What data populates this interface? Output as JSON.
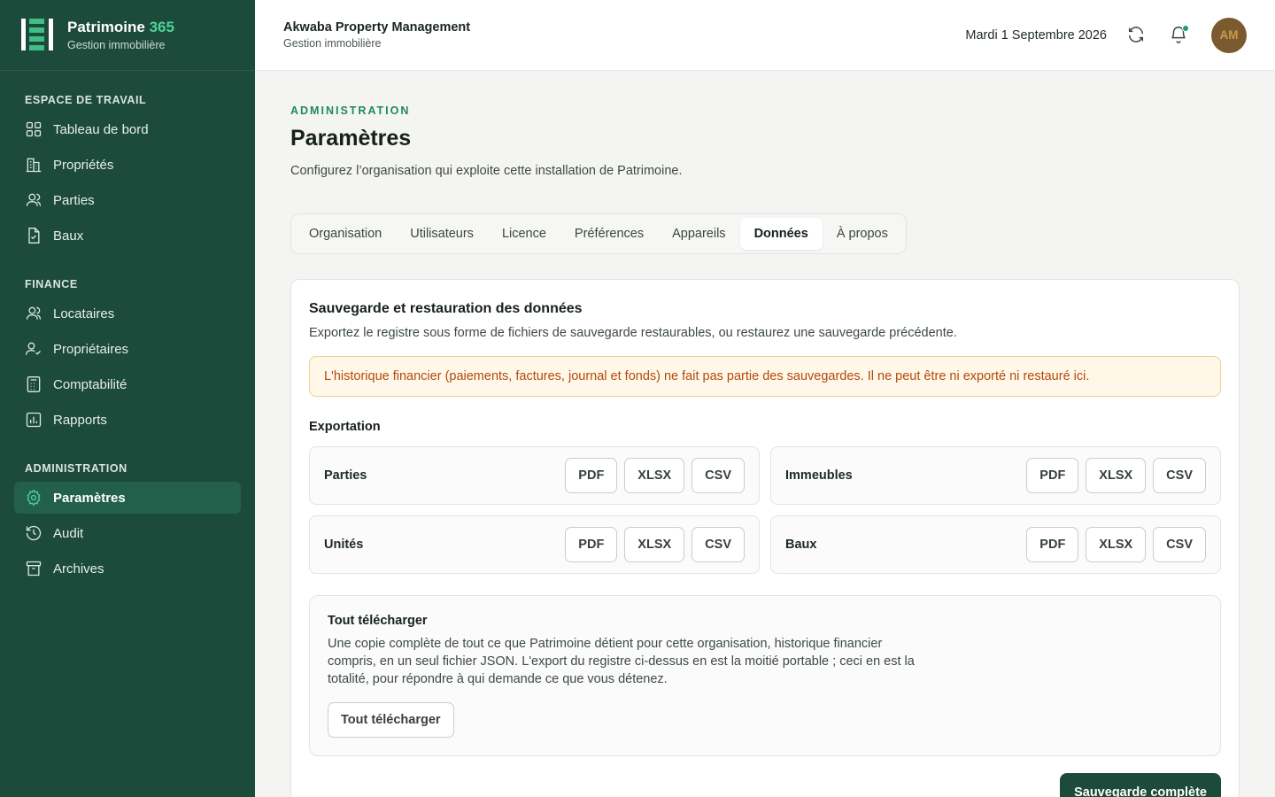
{
  "brand": {
    "name_main": "Patrimoine",
    "name_accent": "365",
    "subtitle": "Gestion immobilière"
  },
  "sidebar": {
    "sections": [
      {
        "heading": "ESPACE DE TRAVAIL",
        "items": [
          {
            "label": "Tableau de bord",
            "icon": "dashboard-icon"
          },
          {
            "label": "Propriétés",
            "icon": "building-icon"
          },
          {
            "label": "Parties",
            "icon": "users-icon"
          },
          {
            "label": "Baux",
            "icon": "document-icon"
          }
        ]
      },
      {
        "heading": "FINANCE",
        "items": [
          {
            "label": "Locataires",
            "icon": "tenants-icon"
          },
          {
            "label": "Propriétaires",
            "icon": "owner-icon"
          },
          {
            "label": "Comptabilité",
            "icon": "calculator-icon"
          },
          {
            "label": "Rapports",
            "icon": "chart-icon"
          }
        ]
      },
      {
        "heading": "ADMINISTRATION",
        "items": [
          {
            "label": "Paramètres",
            "icon": "gear-icon",
            "active": true
          },
          {
            "label": "Audit",
            "icon": "history-icon"
          },
          {
            "label": "Archives",
            "icon": "archive-icon"
          }
        ]
      }
    ]
  },
  "header": {
    "org_name": "Akwaba Property Management",
    "org_subtitle": "Gestion immobilière",
    "date": "Mardi 1 Septembre 2026",
    "avatar_initials": "AM"
  },
  "page": {
    "eyebrow": "ADMINISTRATION",
    "title": "Paramètres",
    "description": "Configurez l’organisation qui exploite cette installation de Patrimoine."
  },
  "tabs": [
    {
      "label": "Organisation"
    },
    {
      "label": "Utilisateurs"
    },
    {
      "label": "Licence"
    },
    {
      "label": "Préférences"
    },
    {
      "label": "Appareils"
    },
    {
      "label": "Données",
      "active": true
    },
    {
      "label": "À propos"
    }
  ],
  "card": {
    "title": "Sauvegarde et restauration des données",
    "description": "Exportez le registre sous forme de fichiers de sauvegarde restaurables, ou restaurez une sauvegarde précédente.",
    "warning": "L'historique financier (paiements, factures, journal et fonds) ne fait pas partie des sauvegardes. Il ne peut être ni exporté ni restauré ici.",
    "export_label": "Exportation",
    "exports": [
      {
        "name": "Parties",
        "formats": [
          "PDF",
          "XLSX",
          "CSV"
        ]
      },
      {
        "name": "Immeubles",
        "formats": [
          "PDF",
          "XLSX",
          "CSV"
        ]
      },
      {
        "name": "Unités",
        "formats": [
          "PDF",
          "XLSX",
          "CSV"
        ]
      },
      {
        "name": "Baux",
        "formats": [
          "PDF",
          "XLSX",
          "CSV"
        ]
      }
    ],
    "download": {
      "title": "Tout télécharger",
      "description": "Une copie complète de tout ce que Patrimoine détient pour cette organisation, historique financier compris, en un seul fichier JSON. L'export du registre ci-dessus en est la moitié portable ; ceci en est la totalité, pour répondre à qui demande ce que vous détenez.",
      "button": "Tout télécharger"
    },
    "primary_button": "Sauvegarde complète"
  },
  "colors": {
    "sidebar_bg": "#1c4a3b",
    "accent": "#1f8a5b",
    "brand_accent": "#4fd39a",
    "warning_text": "#b4480d",
    "warning_bg": "#fff8e8"
  }
}
